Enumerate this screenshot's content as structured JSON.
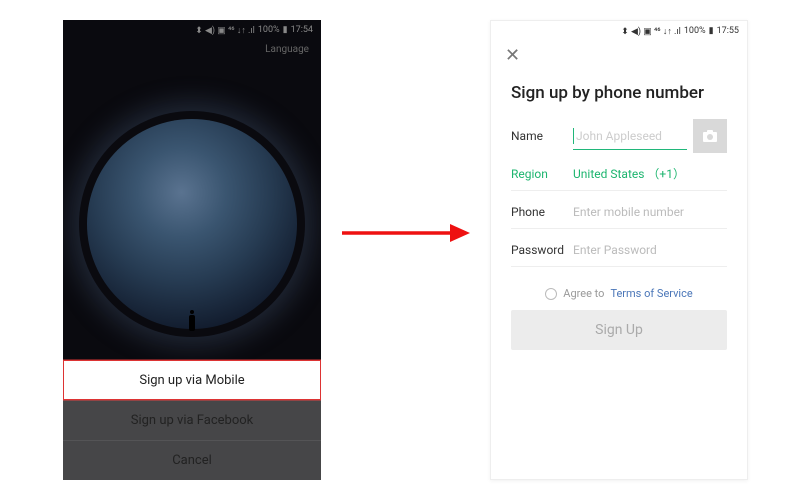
{
  "left": {
    "status": {
      "icons": "⬍ ◀) ▣ ⁴⁶ ↓↑ .ıl",
      "battery": "100%",
      "time": "17:54"
    },
    "language_label": "Language",
    "sheet": {
      "signup_mobile": "Sign up via Mobile",
      "signup_facebook": "Sign up via Facebook",
      "cancel": "Cancel"
    }
  },
  "right": {
    "status": {
      "icons": "⬍ ◀) ▣ ⁴⁶ ↓↑ .ıl",
      "battery": "100%",
      "time": "17:55"
    },
    "close": "✕",
    "title": "Sign up by phone number",
    "fields": {
      "name": {
        "label": "Name",
        "placeholder": "John Appleseed",
        "value": ""
      },
      "region": {
        "label": "Region",
        "value": "United States （+1）"
      },
      "phone": {
        "label": "Phone",
        "placeholder": "Enter mobile number",
        "value": ""
      },
      "password": {
        "label": "Password",
        "placeholder": "Enter Password",
        "value": ""
      }
    },
    "agree": {
      "prefix": "Agree to",
      "terms": "Terms of Service"
    },
    "signup_button": "Sign Up"
  }
}
